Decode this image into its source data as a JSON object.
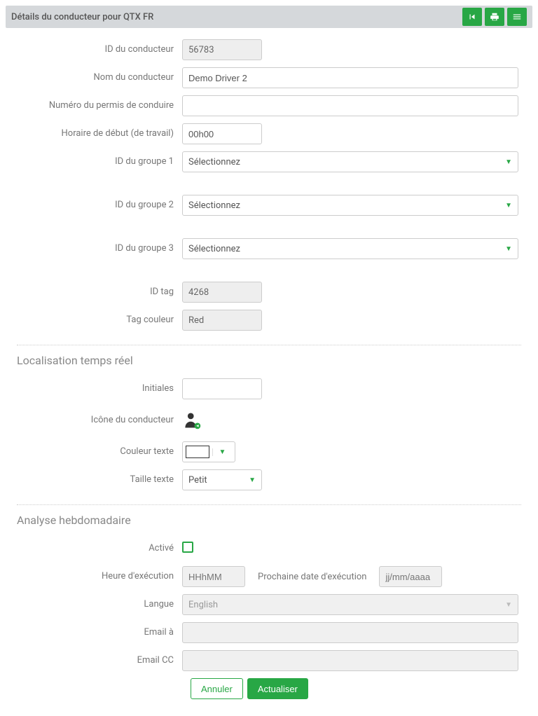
{
  "header": {
    "title": "Détails du conducteur pour QTX FR"
  },
  "labels": {
    "driverId": "ID du conducteur",
    "driverName": "Nom du conducteur",
    "license": "Numéro du permis de conduire",
    "startTime": "Horaire de début (de travail)",
    "group1": "ID du groupe 1",
    "group2": "ID du groupe 2",
    "group3": "ID du groupe 3",
    "idTag": "ID tag",
    "tagColor": "Tag couleur",
    "initials": "Initiales",
    "driverIcon": "Icône du conducteur",
    "textColor": "Couleur texte",
    "textSize": "Taille texte",
    "enabled": "Activé",
    "execTime": "Heure d'exécution",
    "nextExec": "Prochaine date d'exécution",
    "language": "Langue",
    "emailTo": "Email à",
    "emailCc": "Email CC"
  },
  "values": {
    "driverId": "56783",
    "driverName": "Demo Driver 2",
    "startTime": "00h00",
    "groupSelect": "Sélectionnez",
    "idTag": "4268",
    "tagColor": "Red",
    "textSize": "Petit",
    "language": "English",
    "execTimePh": "HHhMM",
    "nextExecPh": "jj/mm/aaaa"
  },
  "sections": {
    "realtime": "Localisation temps réel",
    "weekly": "Analyse hebdomadaire"
  },
  "actions": {
    "cancel": "Annuler",
    "update": "Actualiser"
  }
}
